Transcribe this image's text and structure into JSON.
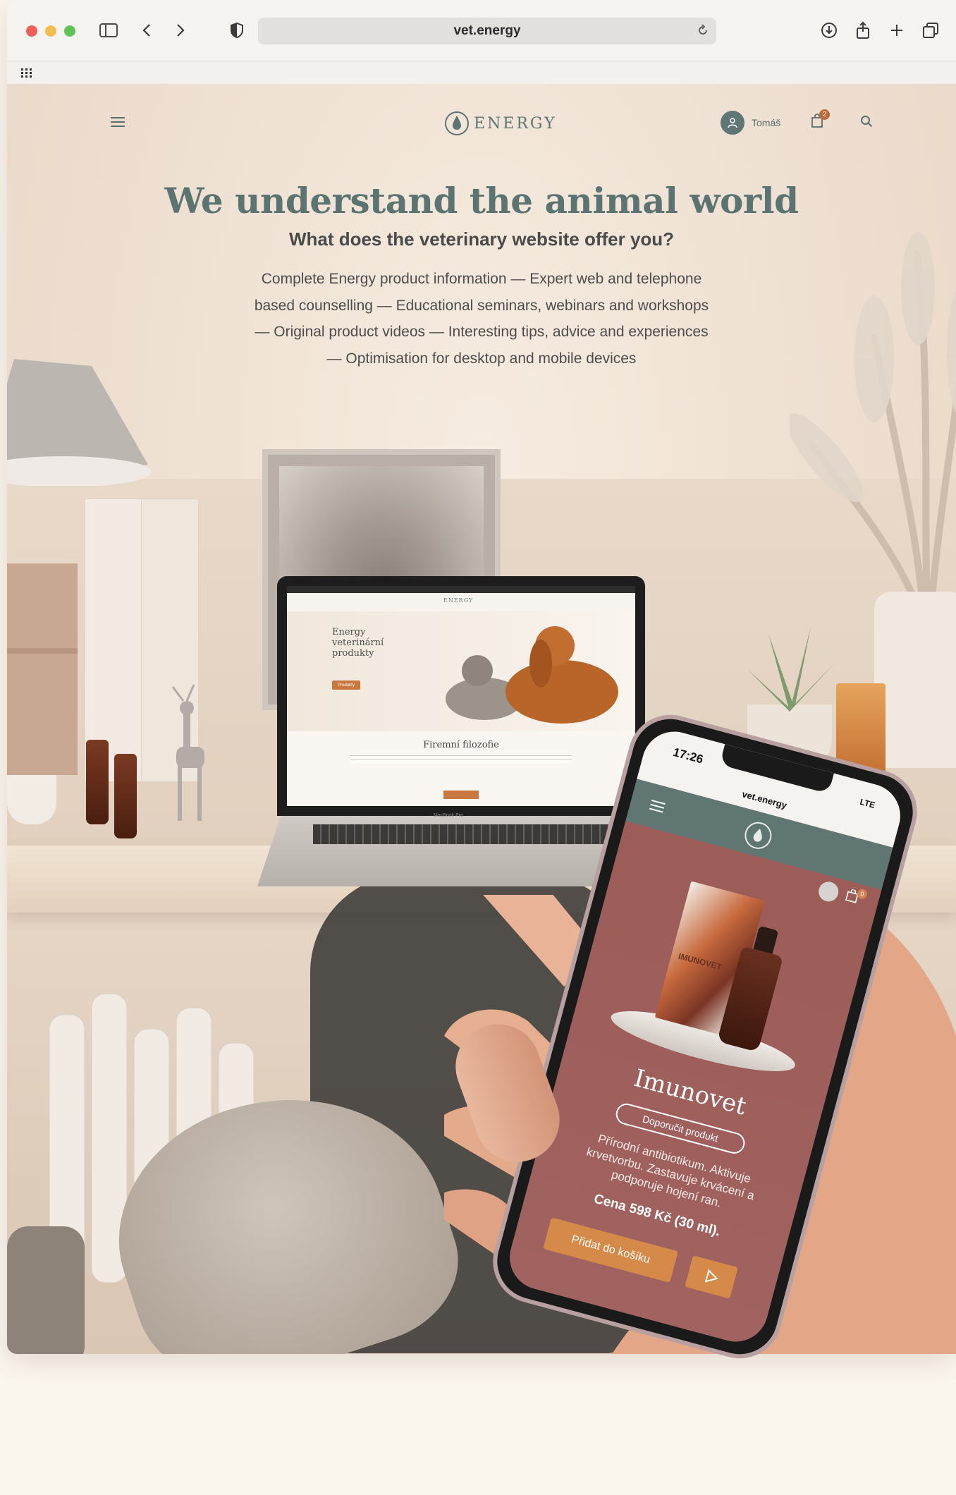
{
  "browser": {
    "url": "vet.energy"
  },
  "header": {
    "logo_text": "ENERGY",
    "user_name": "Tomáš",
    "cart_count": "2"
  },
  "hero": {
    "title": "We understand the animal world",
    "subtitle": "What does the veterinary website offer you?",
    "lines": [
      "Complete Energy product information — Expert web and telephone",
      "based counselling — Educational seminars, webinars and workshops",
      "— Original product videos — Interesting tips, advice and experiences",
      "— Optimisation for desktop and mobile devices"
    ]
  },
  "laptop": {
    "logo_text": "ENERGY",
    "hero_heading": "Energy veterinární produkty",
    "hero_button": "Produkty",
    "section_title": "Firemní filozofie",
    "model_label": "MacBook Pro"
  },
  "phone": {
    "time": "17:26",
    "url": "vet.energy",
    "network": "LTE",
    "cart_count": "0",
    "product_title": "Imunovet",
    "recommend_label": "Doporučit produkt",
    "description": "Přírodní antibiotikum. Aktivuje krvetvorbu. Zastavuje krvácení a podporuje hojení ran.",
    "price": "Cena 598 Kč (30 ml).",
    "add_to_cart": "Přidat do košíku",
    "box_label": "IMUNOVET"
  },
  "icons": {
    "menu": "hamburger-icon",
    "user": "user-icon",
    "cart": "shopping-bag-icon",
    "search": "search-icon",
    "play": "play-icon"
  },
  "colors": {
    "brand_teal": "#5b7471",
    "accent_orange": "#c8773e",
    "phone_bg": "#9b5b57"
  }
}
